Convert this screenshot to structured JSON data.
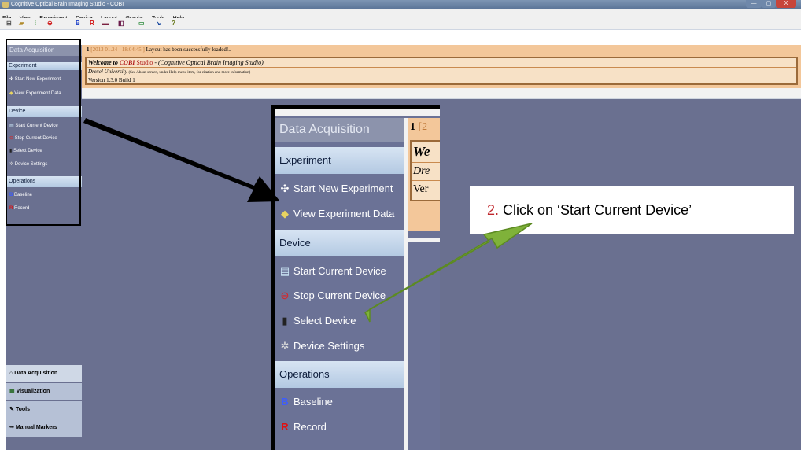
{
  "window": {
    "title": "Cognitive Optical Brain Imaging Studio - COBI",
    "controls": [
      "—",
      "▢",
      "X"
    ]
  },
  "menu": [
    "File",
    "View",
    "Experiment",
    "Device",
    "Layout",
    "Graphs",
    "Tools",
    "Help"
  ],
  "toolbar": {
    "b_label": "B",
    "r_label": "R"
  },
  "sidebar": {
    "title": "Data Acquisition",
    "sections": {
      "experiment": "Experiment",
      "device": "Device",
      "operations": "Operations"
    },
    "items": {
      "start_new_experiment": "Start New Experiment",
      "view_experiment_data": "View Experiment Data",
      "start_current_device": "Start Current Device",
      "stop_current_device": "Stop Current Device",
      "select_device": "Select Device",
      "device_settings": "Device Settings",
      "baseline": "Baseline",
      "record": "Record"
    },
    "bottom_tabs": [
      "Data Acquisition",
      "Visualization",
      "Tools",
      "Manual Markers"
    ]
  },
  "notification": {
    "index": "1",
    "timestamp": "[2013 01.24 - 18:04:45 ]",
    "message": "Layout has been successfully loaded!..",
    "welcome_prefix": "Welcome to",
    "welcome_brand": "COBI",
    "welcome_mid": "Studio",
    "welcome_suffix": "- (Cognitive Optical Brain Imaging Studio)",
    "university": "Drexel University",
    "university_note": "(See About screen, under Help menu item, for citation and more information)",
    "version": "Version 1.3.0 Build 1"
  },
  "zoom_fragments": {
    "index": "1",
    "bracket": "[2",
    "we": "We",
    "dre": "Dre",
    "ver": "Ver"
  },
  "callout": {
    "number": "2.",
    "text": "Click on ‘Start Current Device’"
  },
  "colors": {
    "callout_number": "#c0282d",
    "arrow_green": "#7fb23a",
    "panel": "#6a7090",
    "notif_bg": "#f3c79a"
  }
}
